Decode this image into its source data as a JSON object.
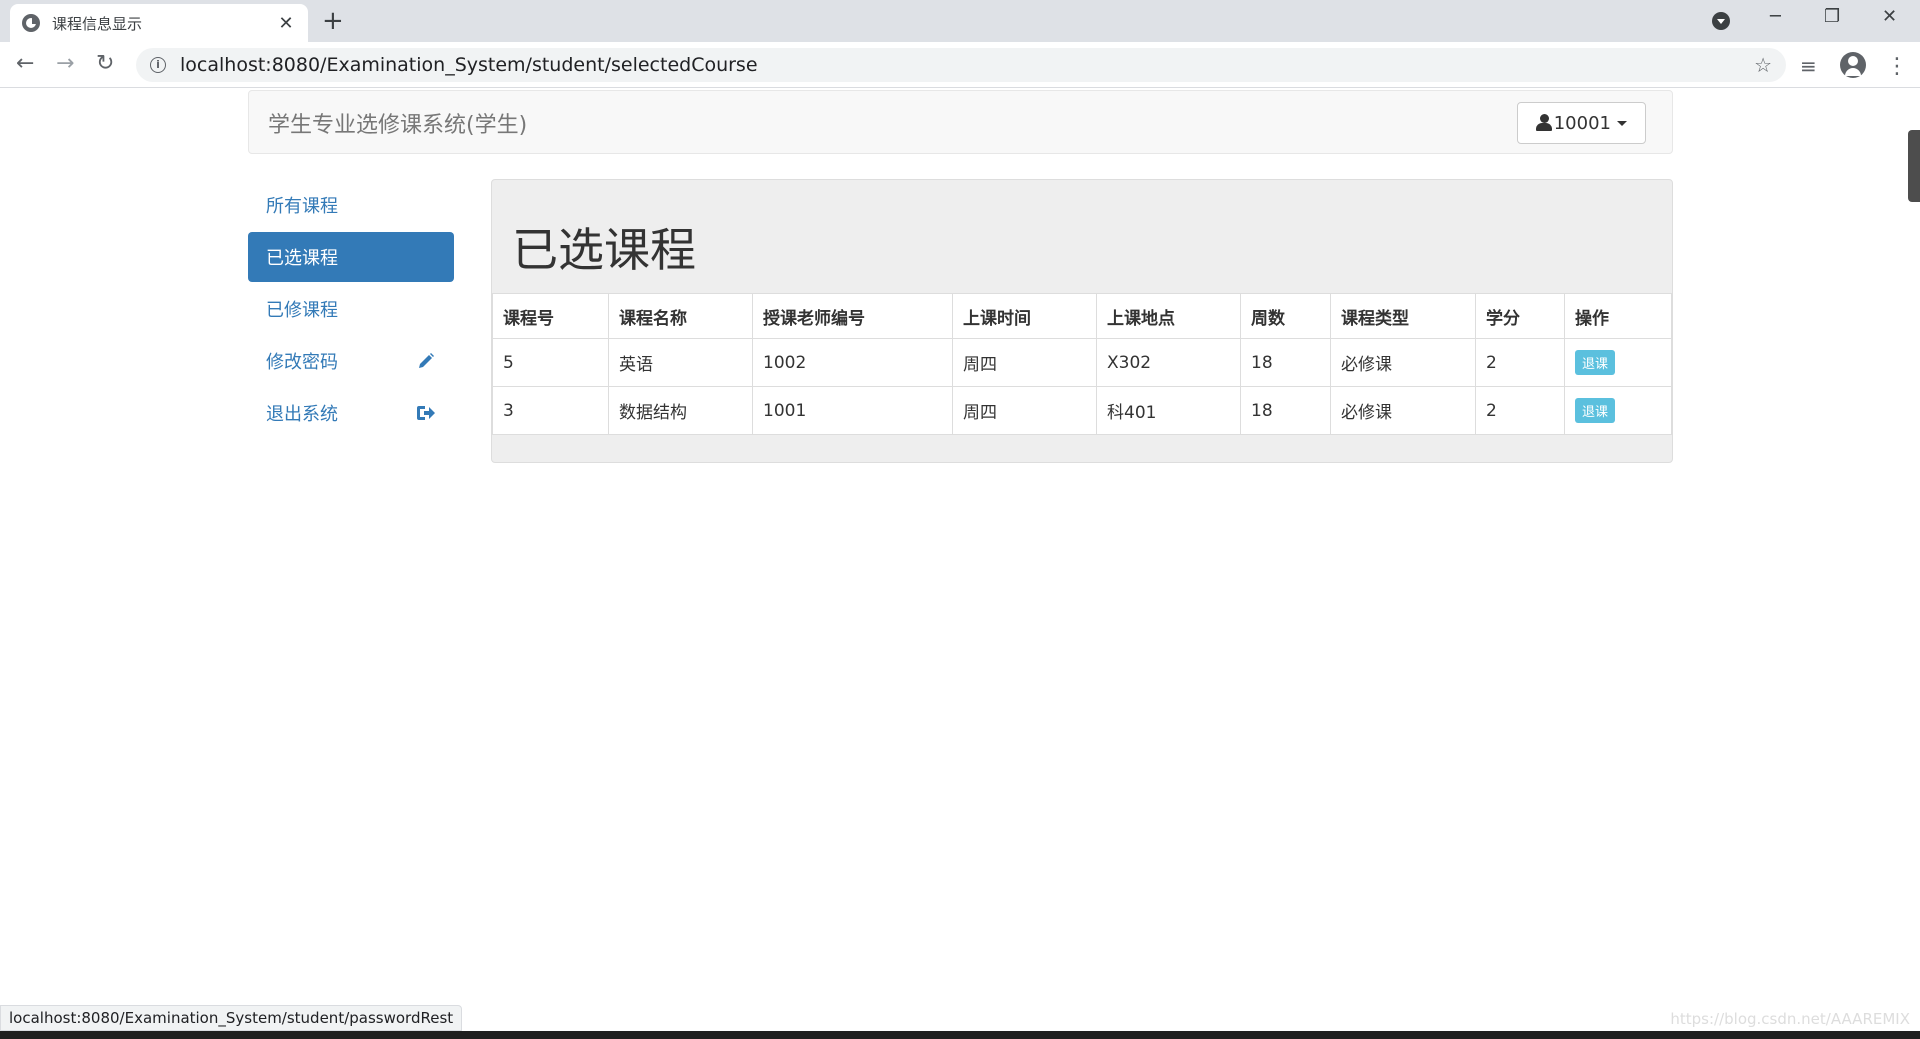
{
  "browser": {
    "tab_title": "课程信息显示",
    "tab_close": "✕",
    "new_tab": "+",
    "url": "localhost:8080/Examination_System/student/selectedCourse",
    "status_url": "localhost:8080/Examination_System/student/passwordRest",
    "controls": {
      "minimize": "─",
      "restore": "❐",
      "close": "✕"
    },
    "nav": {
      "back": "←",
      "forward": "→",
      "reload": "↻",
      "star": "☆",
      "media": "≡",
      "menu": "⋮"
    },
    "watermark": "https://blog.csdn.net/AAAREMIX"
  },
  "navbar": {
    "brand": "学生专业选修课系统(学生)",
    "user": "10001"
  },
  "sidebar": {
    "items": [
      {
        "label": "所有课程",
        "active": false,
        "icon": ""
      },
      {
        "label": "已选课程",
        "active": true,
        "icon": ""
      },
      {
        "label": "已修课程",
        "active": false,
        "icon": ""
      },
      {
        "label": "修改密码",
        "active": false,
        "icon": "pencil-icon"
      },
      {
        "label": "退出系统",
        "active": false,
        "icon": "logout-icon"
      }
    ]
  },
  "main": {
    "title": "已选课程",
    "columns": [
      "课程号",
      "课程名称",
      "授课老师编号",
      "上课时间",
      "上课地点",
      "周数",
      "课程类型",
      "学分",
      "操作"
    ],
    "rows": [
      {
        "cells": [
          "5",
          "英语",
          "1002",
          "周四",
          "X302",
          "18",
          "必修课",
          "2"
        ],
        "action": "退课"
      },
      {
        "cells": [
          "3",
          "数据结构",
          "1001",
          "周四",
          "科401",
          "18",
          "必修课",
          "2"
        ],
        "action": "退课"
      }
    ]
  },
  "colors": {
    "primary": "#337ab7",
    "info": "#5bc0de"
  }
}
